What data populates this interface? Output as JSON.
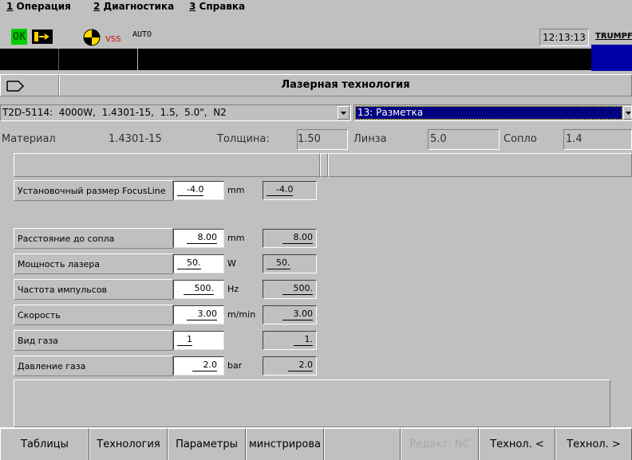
{
  "menu": {
    "items": [
      {
        "num": "1",
        "label": " Операция"
      },
      {
        "num": "2",
        "label": " Диагностика"
      },
      {
        "num": "3",
        "label": " Справка"
      }
    ]
  },
  "status": {
    "ok_label": "OK",
    "vss_label": "VSS",
    "auto_label": "AUTO",
    "time": "12:13:13",
    "brand": "TRUMPF"
  },
  "title": "Лазерная технология",
  "selectors": {
    "program": "T2D-5114:  4000W,  1.4301-15,  1.5,  5.0\",  N2",
    "mode": "13: Разметка"
  },
  "info": {
    "material_label": "Материал",
    "material_value": "1.4301-15",
    "thickness_label": "Толщина:",
    "thickness_value": "1.50",
    "lens_label": "Линза",
    "lens_value": "5.0",
    "nozzle_label": "Сопло",
    "nozzle_value": "1.4"
  },
  "focus": {
    "label": "Установочный размер FocusLine",
    "input": "-4.0",
    "unit": "mm",
    "readout": "-4.0"
  },
  "params": [
    {
      "label": "Расстояние до сопла",
      "input": "8.00",
      "unit": "mm",
      "readout": "8.00"
    },
    {
      "label": "Мощность лазера",
      "input": "50.",
      "unit": "W",
      "readout": "50."
    },
    {
      "label": "Частота импульсов",
      "input": "500.",
      "unit": "Hz",
      "readout": "500."
    },
    {
      "label": "Скорость",
      "input": "3.00",
      "unit": "m/min",
      "readout": "3.00"
    },
    {
      "label": "Вид газа",
      "input": "1",
      "unit": "",
      "readout": "1."
    },
    {
      "label": "Давление газа",
      "input": "2.0",
      "unit": "bar",
      "readout": "2.0"
    }
  ],
  "tabs": [
    {
      "label": "Таблицы"
    },
    {
      "label": "Технология"
    },
    {
      "label": "Параметры"
    },
    {
      "label": "минстрирова"
    },
    {
      "label": ""
    },
    {
      "label": "Редакт. NC"
    },
    {
      "label": "Технол. <"
    },
    {
      "label": "Технол. >"
    }
  ]
}
